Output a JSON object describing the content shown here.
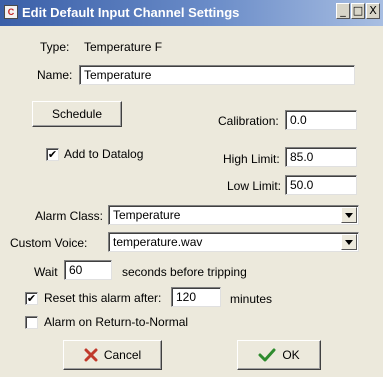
{
  "window": {
    "title": "Edit Default Input Channel Settings",
    "controls": {
      "minimize": "_",
      "maximize": "□",
      "close": "X"
    }
  },
  "type": {
    "label": "Type:",
    "value": "Temperature F"
  },
  "name": {
    "label": "Name:",
    "value": "Temperature"
  },
  "schedule_button": "Schedule",
  "calibration": {
    "label": "Calibration:",
    "value": "0.0"
  },
  "add_to_datalog": {
    "label": "Add to Datalog",
    "checked": true,
    "mark": "✔"
  },
  "high_limit": {
    "label": "High Limit:",
    "value": "85.0"
  },
  "low_limit": {
    "label": "Low Limit:",
    "value": "50.0"
  },
  "alarm_class": {
    "label": "Alarm Class:",
    "value": "Temperature"
  },
  "custom_voice": {
    "label": "Custom Voice:",
    "value": "temperature.wav"
  },
  "wait": {
    "label": "Wait",
    "value": "60",
    "suffix": "seconds before tripping"
  },
  "reset_alarm": {
    "label": "Reset this alarm after:",
    "checked": true,
    "mark": "✔",
    "value": "120",
    "suffix": "minutes"
  },
  "alarm_return": {
    "label": "Alarm on Return-to-Normal",
    "checked": false,
    "mark": ""
  },
  "cancel_button": {
    "label": "Cancel",
    "icon": "red-x-icon"
  },
  "ok_button": {
    "label": "OK",
    "icon": "green-check-icon"
  },
  "colors": {
    "title_start": "#3a5fa8",
    "title_end": "#a8bee2",
    "dialog_bg": "#ece9dc",
    "cancel_icon": "#c0392b",
    "ok_icon": "#2e8b2e"
  }
}
